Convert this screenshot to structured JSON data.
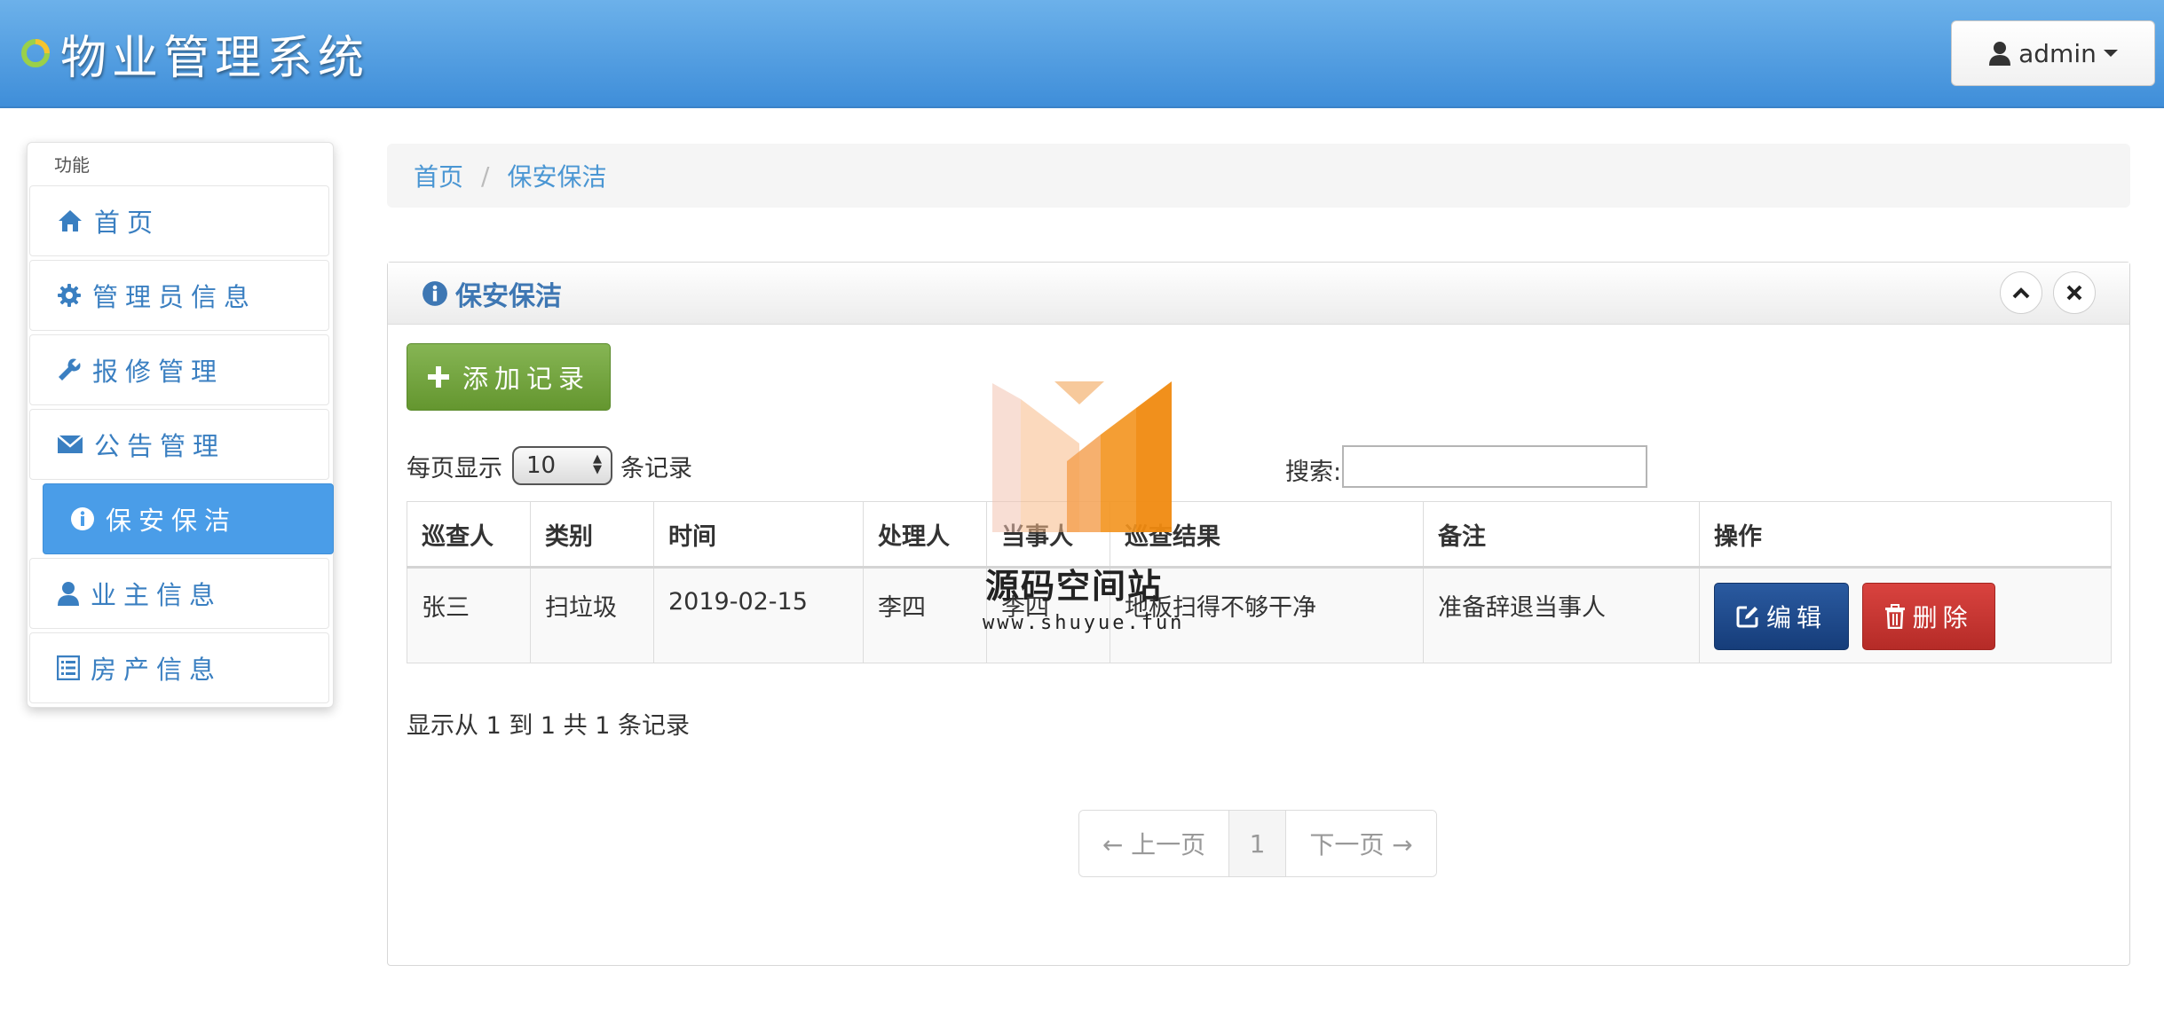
{
  "app": {
    "title": "物业管理系统",
    "user": "admin"
  },
  "sidebar": {
    "header": "功能",
    "items": [
      {
        "label": "首页",
        "icon": "home-icon"
      },
      {
        "label": "管理员信息",
        "icon": "gear-icon"
      },
      {
        "label": "报修管理",
        "icon": "wrench-icon"
      },
      {
        "label": "公告管理",
        "icon": "envelope-icon"
      },
      {
        "label": "保安保洁",
        "icon": "info-icon",
        "active": true
      },
      {
        "label": "业主信息",
        "icon": "user-icon"
      },
      {
        "label": "房产信息",
        "icon": "list-icon"
      }
    ]
  },
  "breadcrumb": {
    "home": "首页",
    "separator": "/",
    "current": "保安保洁"
  },
  "panel": {
    "title": "保安保洁",
    "add_button": "添加记录",
    "length_prefix": "每页显示",
    "length_value": "10",
    "length_suffix": "条记录",
    "search_label": "搜索:",
    "search_value": ""
  },
  "table": {
    "headers": [
      "巡查人",
      "类别",
      "时间",
      "处理人",
      "当事人",
      "巡查结果",
      "备注",
      "操作"
    ],
    "rows": [
      {
        "cells": [
          "张三",
          "扫垃圾",
          "2019-02-15",
          "李四",
          "李四",
          "地板扫得不够干净",
          "准备辞退当事人"
        ],
        "edit": "编辑",
        "delete": "删除"
      }
    ],
    "info": "显示从 1 到 1 共 1 条记录"
  },
  "pagination": {
    "prev": "← 上一页",
    "page": "1",
    "next": "下一页 →"
  },
  "watermark": {
    "text": "源码空间站",
    "url": "www.shuyue.fun"
  },
  "colors": {
    "header": "#4a9be4",
    "link": "#4a96d3",
    "active_nav": "#4a9de8",
    "add": "#72a53e",
    "edit": "#1f4b8e",
    "delete": "#c9302c"
  }
}
